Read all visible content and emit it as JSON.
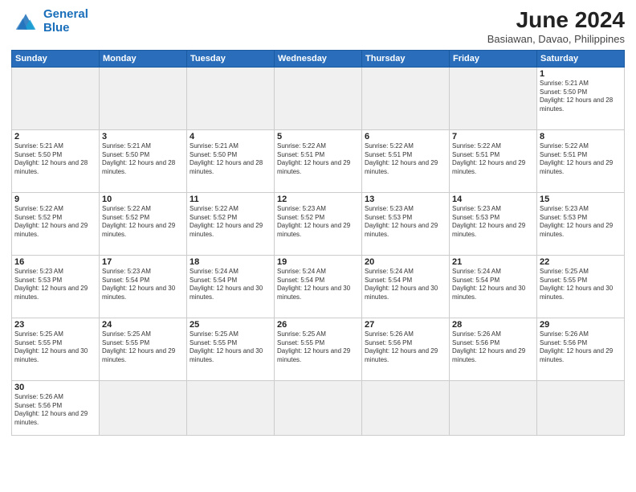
{
  "logo": {
    "line1": "General",
    "line2": "Blue"
  },
  "title": "June 2024",
  "subtitle": "Basiawan, Davao, Philippines",
  "days_of_week": [
    "Sunday",
    "Monday",
    "Tuesday",
    "Wednesday",
    "Thursday",
    "Friday",
    "Saturday"
  ],
  "weeks": [
    [
      {
        "day": "",
        "empty": true
      },
      {
        "day": "",
        "empty": true
      },
      {
        "day": "",
        "empty": true
      },
      {
        "day": "",
        "empty": true
      },
      {
        "day": "",
        "empty": true
      },
      {
        "day": "",
        "empty": true
      },
      {
        "day": "1",
        "sunrise": "5:21 AM",
        "sunset": "5:50 PM",
        "daylight": "12 hours and 28 minutes."
      }
    ],
    [
      {
        "day": "2",
        "sunrise": "5:21 AM",
        "sunset": "5:50 PM",
        "daylight": "12 hours and 28 minutes."
      },
      {
        "day": "3",
        "sunrise": "5:21 AM",
        "sunset": "5:50 PM",
        "daylight": "12 hours and 28 minutes."
      },
      {
        "day": "4",
        "sunrise": "5:21 AM",
        "sunset": "5:50 PM",
        "daylight": "12 hours and 28 minutes."
      },
      {
        "day": "5",
        "sunrise": "5:22 AM",
        "sunset": "5:51 PM",
        "daylight": "12 hours and 29 minutes."
      },
      {
        "day": "6",
        "sunrise": "5:22 AM",
        "sunset": "5:51 PM",
        "daylight": "12 hours and 29 minutes."
      },
      {
        "day": "7",
        "sunrise": "5:22 AM",
        "sunset": "5:51 PM",
        "daylight": "12 hours and 29 minutes."
      },
      {
        "day": "8",
        "sunrise": "5:22 AM",
        "sunset": "5:51 PM",
        "daylight": "12 hours and 29 minutes."
      }
    ],
    [
      {
        "day": "9",
        "sunrise": "5:22 AM",
        "sunset": "5:52 PM",
        "daylight": "12 hours and 29 minutes."
      },
      {
        "day": "10",
        "sunrise": "5:22 AM",
        "sunset": "5:52 PM",
        "daylight": "12 hours and 29 minutes."
      },
      {
        "day": "11",
        "sunrise": "5:22 AM",
        "sunset": "5:52 PM",
        "daylight": "12 hours and 29 minutes."
      },
      {
        "day": "12",
        "sunrise": "5:23 AM",
        "sunset": "5:52 PM",
        "daylight": "12 hours and 29 minutes."
      },
      {
        "day": "13",
        "sunrise": "5:23 AM",
        "sunset": "5:53 PM",
        "daylight": "12 hours and 29 minutes."
      },
      {
        "day": "14",
        "sunrise": "5:23 AM",
        "sunset": "5:53 PM",
        "daylight": "12 hours and 29 minutes."
      },
      {
        "day": "15",
        "sunrise": "5:23 AM",
        "sunset": "5:53 PM",
        "daylight": "12 hours and 29 minutes."
      }
    ],
    [
      {
        "day": "16",
        "sunrise": "5:23 AM",
        "sunset": "5:53 PM",
        "daylight": "12 hours and 29 minutes."
      },
      {
        "day": "17",
        "sunrise": "5:23 AM",
        "sunset": "5:54 PM",
        "daylight": "12 hours and 30 minutes."
      },
      {
        "day": "18",
        "sunrise": "5:24 AM",
        "sunset": "5:54 PM",
        "daylight": "12 hours and 30 minutes."
      },
      {
        "day": "19",
        "sunrise": "5:24 AM",
        "sunset": "5:54 PM",
        "daylight": "12 hours and 30 minutes."
      },
      {
        "day": "20",
        "sunrise": "5:24 AM",
        "sunset": "5:54 PM",
        "daylight": "12 hours and 30 minutes."
      },
      {
        "day": "21",
        "sunrise": "5:24 AM",
        "sunset": "5:54 PM",
        "daylight": "12 hours and 30 minutes."
      },
      {
        "day": "22",
        "sunrise": "5:25 AM",
        "sunset": "5:55 PM",
        "daylight": "12 hours and 30 minutes."
      }
    ],
    [
      {
        "day": "23",
        "sunrise": "5:25 AM",
        "sunset": "5:55 PM",
        "daylight": "12 hours and 30 minutes."
      },
      {
        "day": "24",
        "sunrise": "5:25 AM",
        "sunset": "5:55 PM",
        "daylight": "12 hours and 29 minutes."
      },
      {
        "day": "25",
        "sunrise": "5:25 AM",
        "sunset": "5:55 PM",
        "daylight": "12 hours and 30 minutes."
      },
      {
        "day": "26",
        "sunrise": "5:25 AM",
        "sunset": "5:55 PM",
        "daylight": "12 hours and 29 minutes."
      },
      {
        "day": "27",
        "sunrise": "5:26 AM",
        "sunset": "5:56 PM",
        "daylight": "12 hours and 29 minutes."
      },
      {
        "day": "28",
        "sunrise": "5:26 AM",
        "sunset": "5:56 PM",
        "daylight": "12 hours and 29 minutes."
      },
      {
        "day": "29",
        "sunrise": "5:26 AM",
        "sunset": "5:56 PM",
        "daylight": "12 hours and 29 minutes."
      }
    ],
    [
      {
        "day": "30",
        "sunrise": "5:26 AM",
        "sunset": "5:56 PM",
        "daylight": "12 hours and 29 minutes."
      },
      {
        "day": "",
        "empty": true
      },
      {
        "day": "",
        "empty": true
      },
      {
        "day": "",
        "empty": true
      },
      {
        "day": "",
        "empty": true
      },
      {
        "day": "",
        "empty": true
      },
      {
        "day": "",
        "empty": true
      }
    ]
  ],
  "labels": {
    "sunrise": "Sunrise:",
    "sunset": "Sunset:",
    "daylight": "Daylight:"
  }
}
